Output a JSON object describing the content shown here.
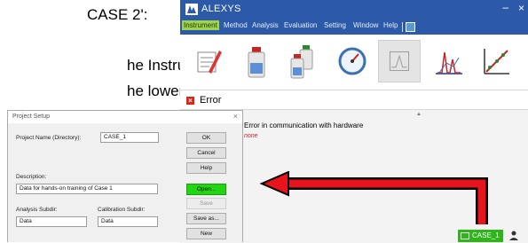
{
  "slide": {
    "line1": "CASE 2':",
    "line2": "he Instrument",
    "line3": "he lower right"
  },
  "window": {
    "title": "ALEXYS",
    "controls": {
      "minimize": "–",
      "close": "×"
    }
  },
  "menu": {
    "items": [
      "Instrument",
      "Method",
      "Analysis",
      "Evaluation",
      "Setting",
      "Window",
      "Help"
    ],
    "active": "Instrument"
  },
  "toolbar": {
    "tools": [
      "edit-icon",
      "bottle-icon",
      "bottles-icon",
      "gauge-icon",
      "chromatogram-icon",
      "chart-peaks-icon",
      "calibration-icon"
    ],
    "disabled_tool": "chromatogram-icon"
  },
  "error_panel": {
    "title": "Error",
    "message": "Error in communication with hardware",
    "detail": "none",
    "grip": "▲"
  },
  "status_bar": {
    "case_label": "CASE_1"
  },
  "project_setup": {
    "title": "Project Setup",
    "close": "×",
    "project_name_label": "Project Name (Directory):",
    "project_name_value": "CASE_1",
    "description_label": "Description:",
    "description_value": "Data for hands-on training of Case 1",
    "analysis_subdir_label": "Analysis Subdir:",
    "analysis_subdir_value": "Data",
    "calibration_subdir_label": "Calibration Subdir:",
    "calibration_subdir_value": "Data",
    "buttons": {
      "ok": "OK",
      "cancel": "Cancel",
      "help": "Help",
      "open": "Open...",
      "save": "Save",
      "save_as": "Save as...",
      "new": "New"
    }
  },
  "colors": {
    "window_blue": "#2c5aa8",
    "menu_active": "#9fd24d",
    "open_button": "#22d411",
    "case_badge": "#2db51a",
    "arrow_red": "#e8141b",
    "error_red": "#d9261c"
  }
}
